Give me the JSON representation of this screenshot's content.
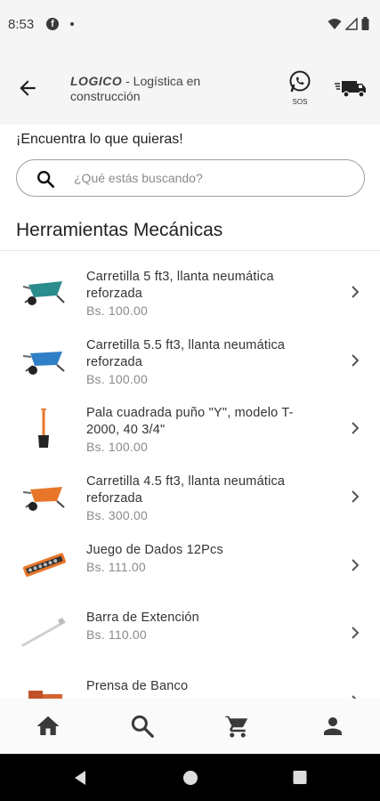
{
  "status": {
    "time": "8:53"
  },
  "app": {
    "brand": "LOGICO",
    "subtitle": " - Logística en construcción",
    "sos_label": "SOS"
  },
  "search": {
    "prompt": "¡Encuentra lo que quieras!",
    "placeholder": "¿Qué estás buscando?"
  },
  "section": {
    "title": "Herramientas Mecánicas"
  },
  "products": [
    {
      "name": "Carretilla 5 ft3, llanta neumática reforzada",
      "price": "Bs. 100.00",
      "icon": "wheelbarrow-teal"
    },
    {
      "name": "Carretilla 5.5 ft3, llanta neumática reforzada",
      "price": "Bs. 100.00",
      "icon": "wheelbarrow-blue"
    },
    {
      "name": "Pala cuadrada puño \"Y\", modelo T-2000, 40 3/4\"",
      "price": "Bs. 100.00",
      "icon": "shovel"
    },
    {
      "name": "Carretilla 4.5 ft3, llanta neumática reforzada",
      "price": "Bs. 300.00",
      "icon": "wheelbarrow-orange"
    },
    {
      "name": "Juego de Dados 12Pcs",
      "price": "Bs. 111.00",
      "icon": "socket-set"
    },
    {
      "name": "Barra de Extención",
      "price": "Bs. 110.00",
      "icon": "extension-bar"
    },
    {
      "name": "Prensa de Banco",
      "price": "",
      "icon": "bench-vise"
    }
  ],
  "colors": {
    "teal": "#2a8c8c",
    "blue": "#2f7fc6",
    "orange": "#e8762a",
    "accent": "#444444"
  }
}
